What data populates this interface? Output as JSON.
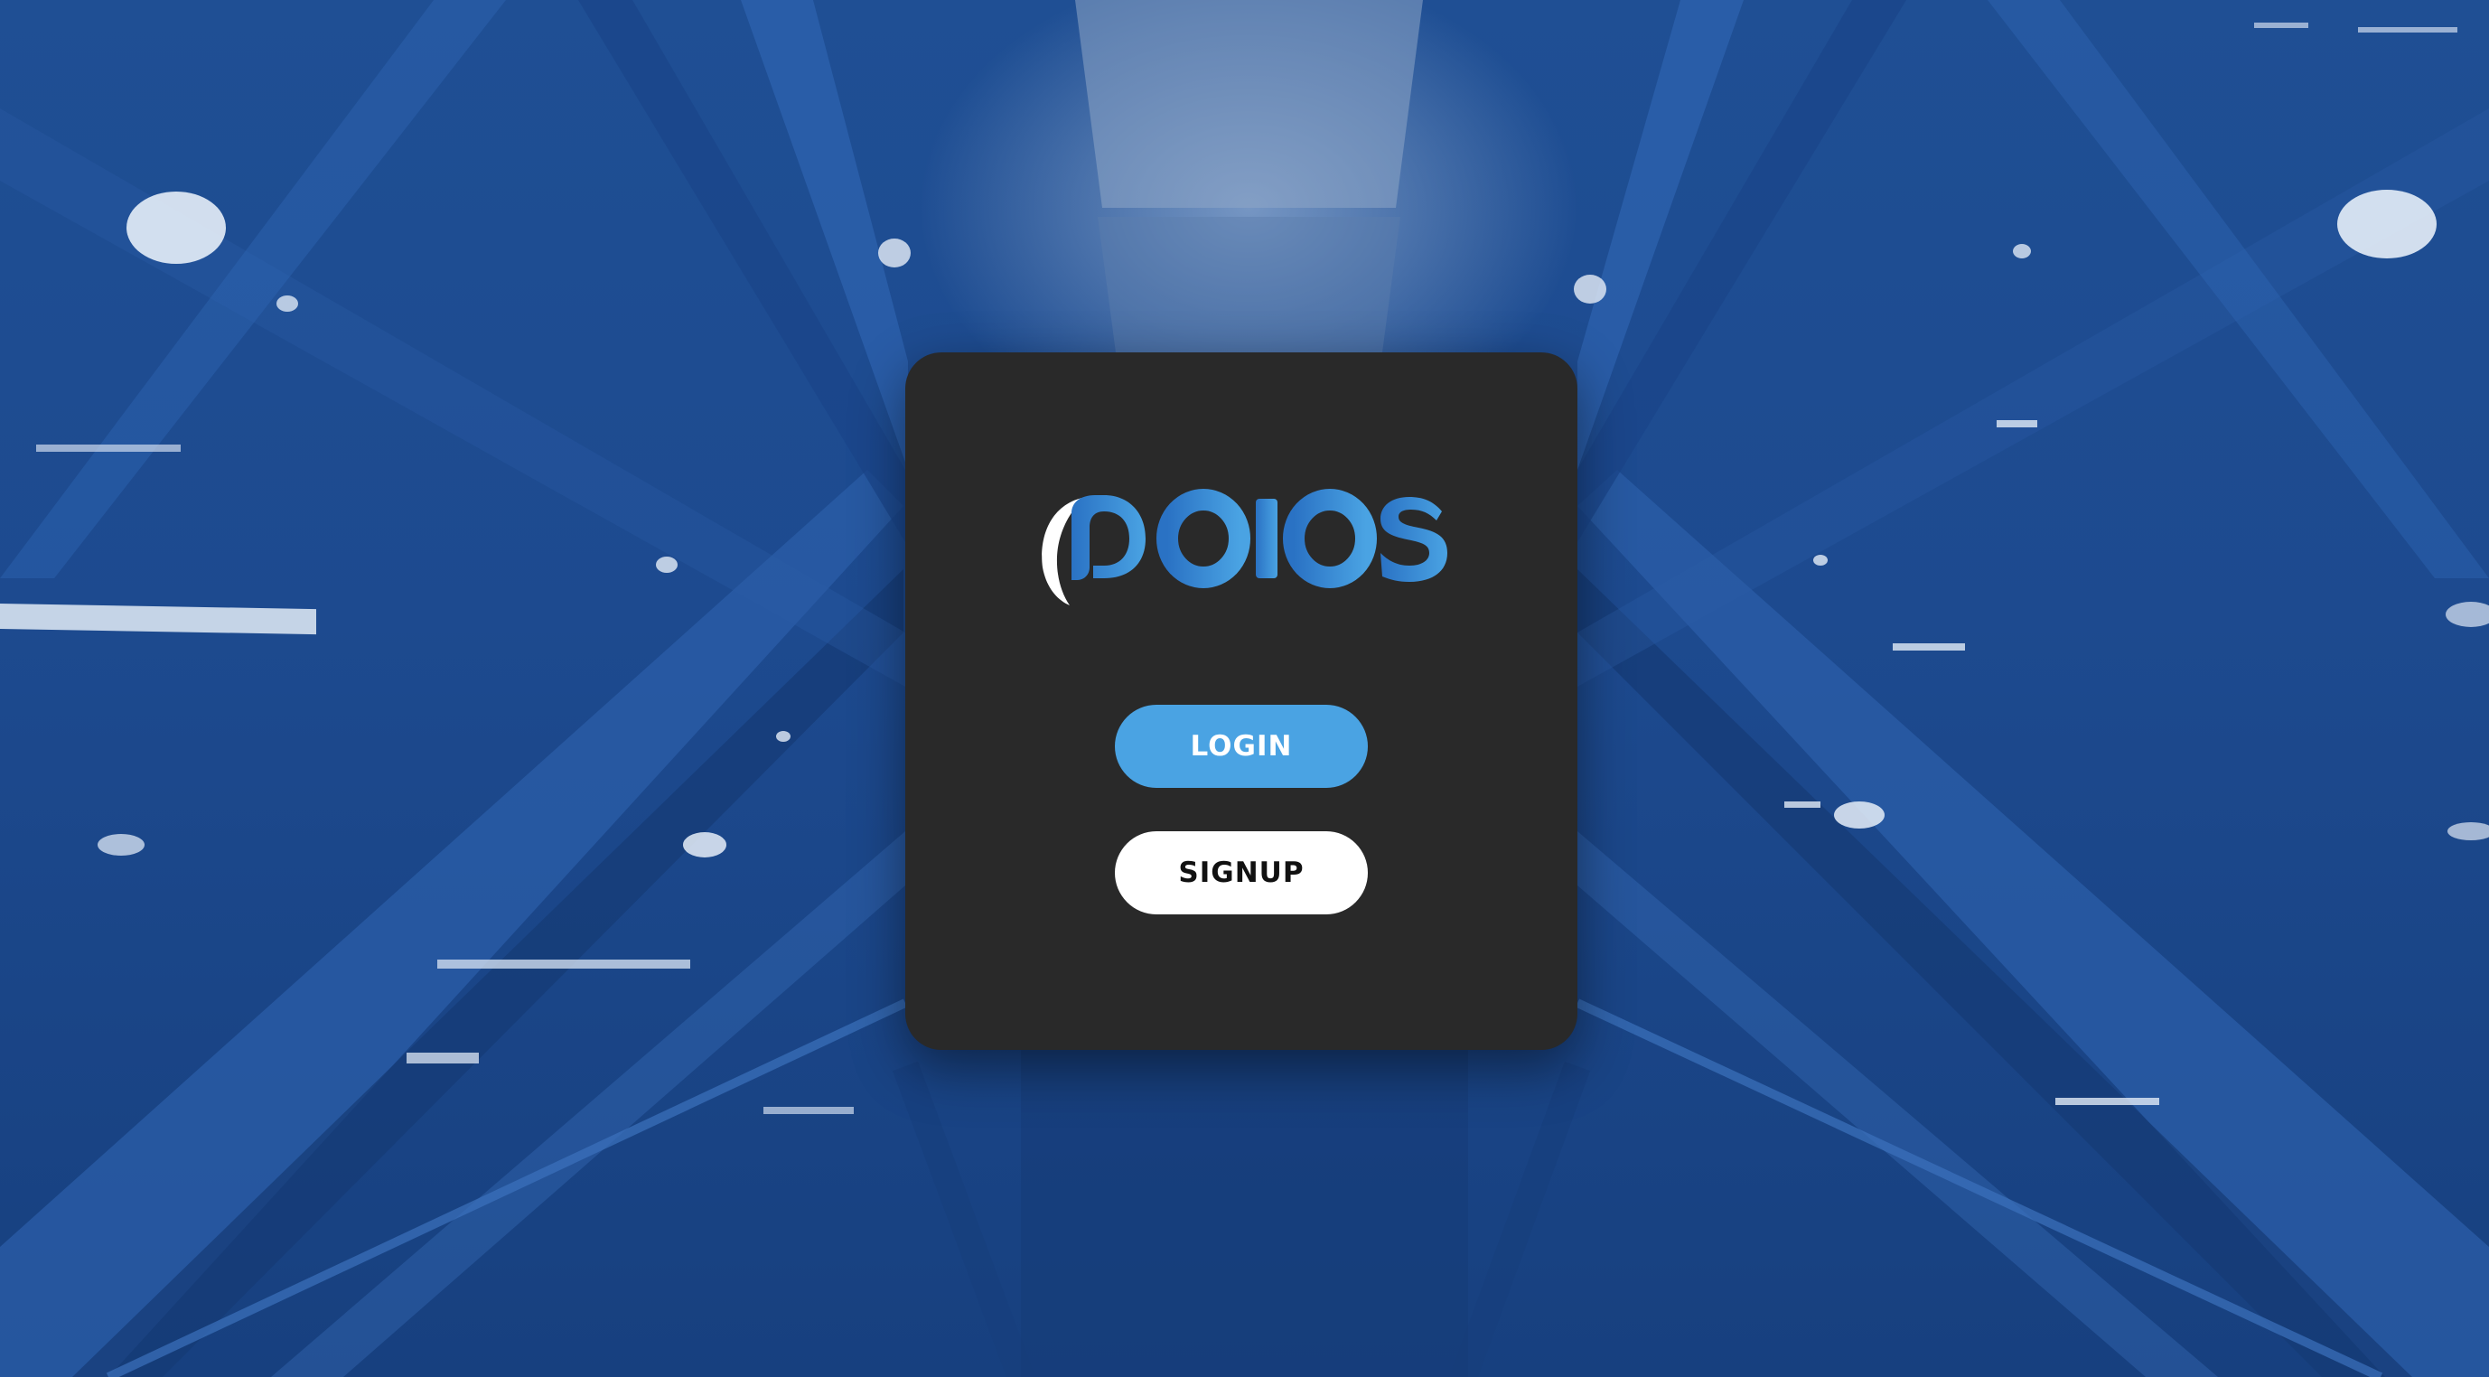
{
  "app": {
    "logo_text": "poios",
    "icon": "poios-logo"
  },
  "actions": {
    "login_label": "LOGIN",
    "signup_label": "SIGNUP"
  },
  "colors": {
    "background": "#1d4a8f",
    "card": "#292929",
    "accent": "#4aa3e3",
    "signup_button": "#ffffff",
    "signup_text": "#111111"
  }
}
